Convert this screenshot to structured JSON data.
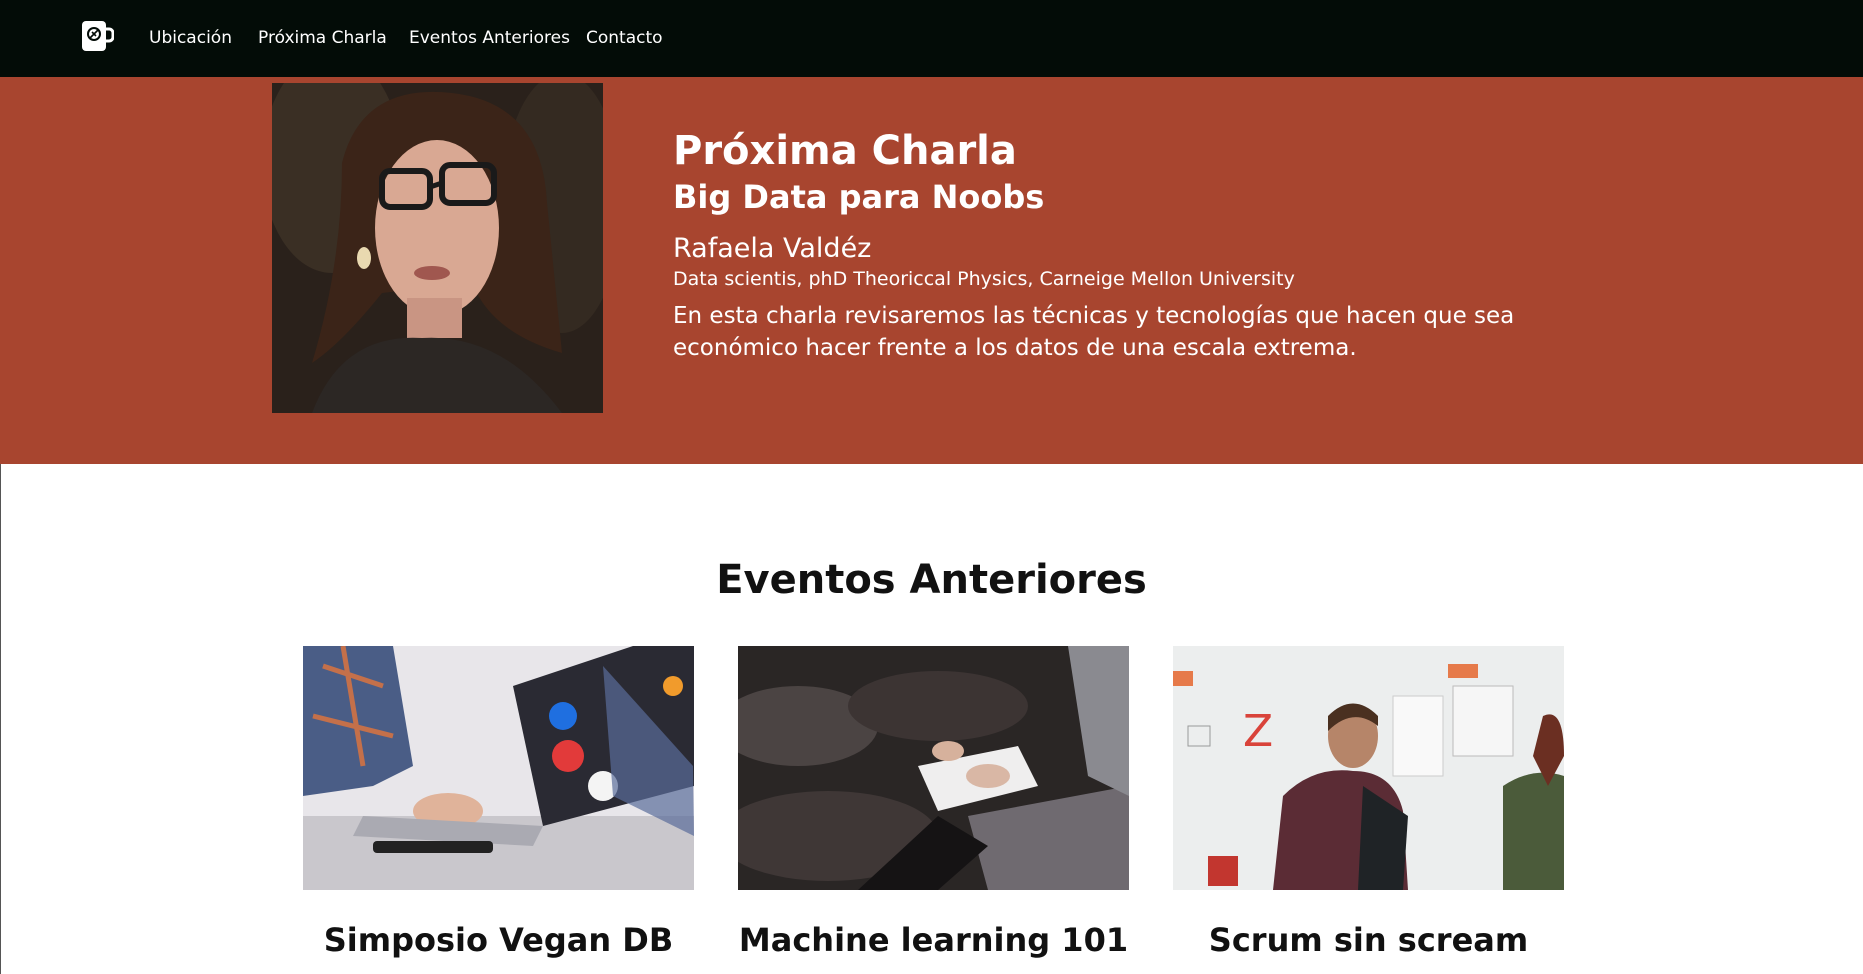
{
  "nav": {
    "logo_icon": "coffee-mug-icon",
    "links": [
      "Ubicación",
      "Próxima Charla",
      "Eventos Anteriores",
      "Contacto"
    ]
  },
  "hero": {
    "kicker": "Próxima Charla",
    "title": "Big Data para Noobs",
    "speaker": "Rafaela Valdéz",
    "credentials": "Data scientis, phD Theoriccal Physics, Carneige Mellon University",
    "description": "En esta charla revisaremos las técnicas y tecnologías que hacen que sea económico hacer frente a los datos de una escala extrema.",
    "background_color": "#a8452f"
  },
  "past_events": {
    "title": "Eventos Anteriores",
    "events": [
      {
        "title": "Simposio Vegan DB"
      },
      {
        "title": "Machine learning 101"
      },
      {
        "title": "Scrum sin scream"
      }
    ]
  },
  "colors": {
    "navbar": "#030c07",
    "hero": "#a8452f",
    "text": "#111111"
  }
}
